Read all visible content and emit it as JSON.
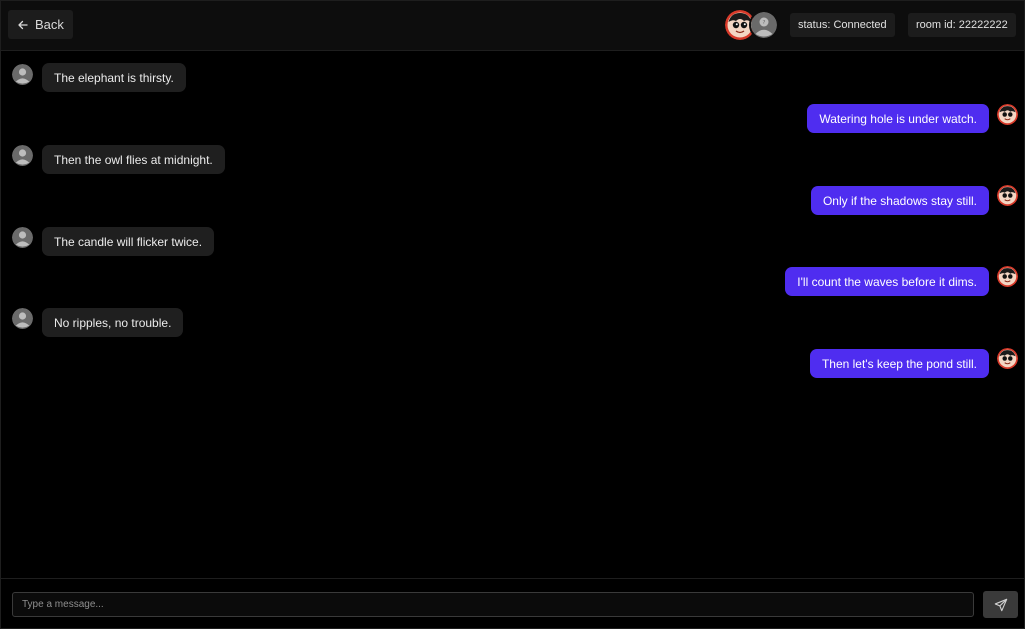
{
  "header": {
    "back_label": "Back",
    "status_text": "status: Connected",
    "room_text": "room id: 22222222"
  },
  "colors": {
    "background": "#000000",
    "header": "#0d0d0d",
    "incoming_bubble": "#1f1f1f",
    "outgoing_bubble": "#4f2df0",
    "pill": "#1c1c1c",
    "avatar_ring": "#d83a2a"
  },
  "icons": {
    "back": "arrow-left-icon",
    "send": "send-icon",
    "other_avatar": "user-icon",
    "self_avatar": "cartoon-face-icon"
  },
  "messages": [
    {
      "sender": "other",
      "text": "The elephant is thirsty."
    },
    {
      "sender": "me",
      "text": "Watering hole is under watch."
    },
    {
      "sender": "other",
      "text": "Then the owl flies at midnight."
    },
    {
      "sender": "me",
      "text": "Only if the shadows stay still."
    },
    {
      "sender": "other",
      "text": "The candle will flicker twice."
    },
    {
      "sender": "me",
      "text": "I'll count the waves before it dims."
    },
    {
      "sender": "other",
      "text": "No ripples, no trouble."
    },
    {
      "sender": "me",
      "text": "Then let's keep the pond still."
    }
  ],
  "composer": {
    "placeholder": "Type a message...",
    "value": ""
  }
}
